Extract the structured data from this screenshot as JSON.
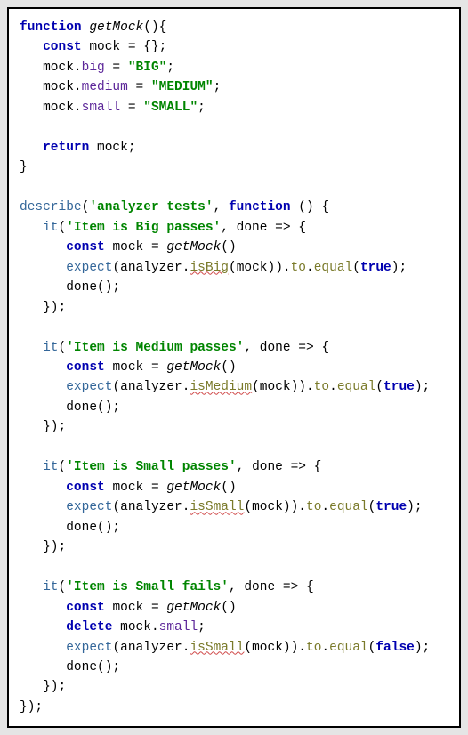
{
  "tokens": {
    "kw_function": "function",
    "kw_const": "const",
    "kw_return": "return",
    "kw_delete": "delete",
    "fn_getMock": "getMock",
    "id_mock": "mock",
    "prop_big": "big",
    "prop_medium": "medium",
    "prop_small": "small",
    "str_BIG": "\"BIG\"",
    "str_MEDIUM": "\"MEDIUM\"",
    "str_SMALL": "\"SMALL\"",
    "fn_describe": "describe",
    "fn_it": "it",
    "fn_expect": "expect",
    "fn_done": "done",
    "id_analyzer": "analyzer",
    "m_isBig": "isBig",
    "m_isMedium": "isMedium",
    "m_isSmall": "isSmall",
    "chain_to": "to",
    "chain_equal": "equal",
    "bool_true": "true",
    "bool_false": "false",
    "str_suite": "'analyzer tests'",
    "str_t1": "'Item is Big passes'",
    "str_t2": "'Item is Medium passes'",
    "str_t3": "'Item is Small passes'",
    "str_t4": "'Item is Small fails'"
  }
}
